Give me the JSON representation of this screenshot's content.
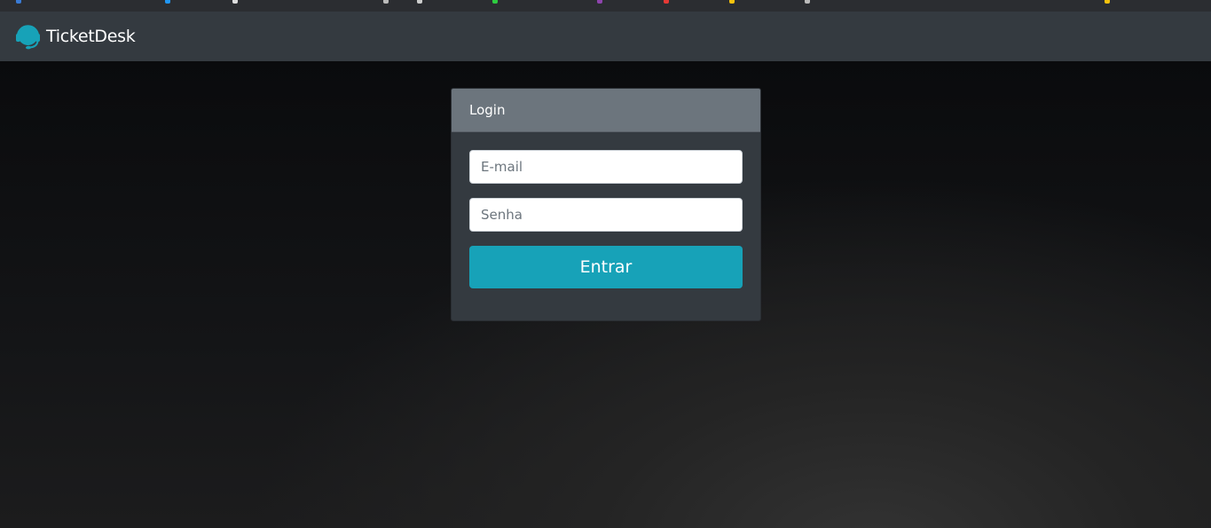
{
  "navbar": {
    "brand_name": "TicketDesk",
    "brand_icon": "headset-icon"
  },
  "login": {
    "header": "Login",
    "email_placeholder": "E-mail",
    "password_placeholder": "Senha",
    "submit_label": "Entrar"
  },
  "colors": {
    "navbar_bg": "#343a40",
    "card_header_bg": "#6c757d",
    "button_bg": "#17a2b8",
    "brand_icon": "#17a2b8"
  }
}
